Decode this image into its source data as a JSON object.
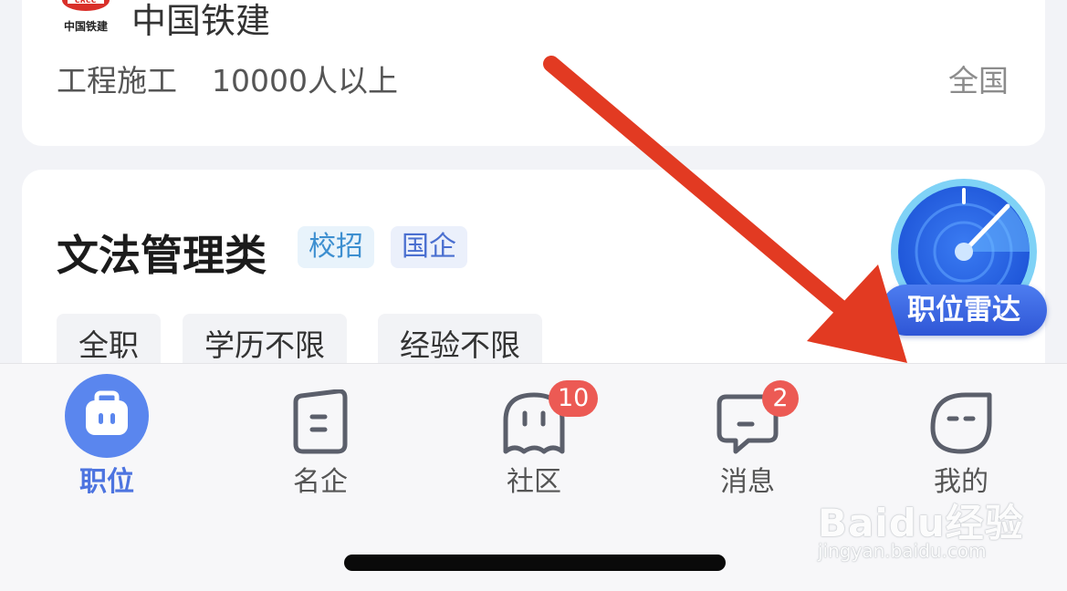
{
  "company_card": {
    "logo_text": "中国铁建",
    "name": "中国铁建",
    "industry": "工程施工",
    "size": "10000人以上",
    "location": "全国"
  },
  "job_card": {
    "title": "文法管理类",
    "tags": [
      "校招",
      "国企"
    ],
    "chips": [
      "全职",
      "学历不限",
      "经验不限"
    ],
    "radar_label": "职位雷达"
  },
  "tabbar": {
    "items": [
      {
        "label": "职位",
        "icon": "briefcase-icon",
        "active": true
      },
      {
        "label": "名企",
        "icon": "building-card-icon",
        "active": false
      },
      {
        "label": "社区",
        "icon": "ghost-icon",
        "active": false,
        "badge": "10"
      },
      {
        "label": "消息",
        "icon": "message-bubble-icon",
        "active": false,
        "badge": "2"
      },
      {
        "label": "我的",
        "icon": "face-icon",
        "active": false
      }
    ]
  },
  "watermark": {
    "brand": "Baidu经验",
    "url": "jingyan.baidu.com"
  },
  "colors": {
    "accent": "#4d74e0",
    "badge": "#ec5a54",
    "arrow": "#e23a22"
  }
}
